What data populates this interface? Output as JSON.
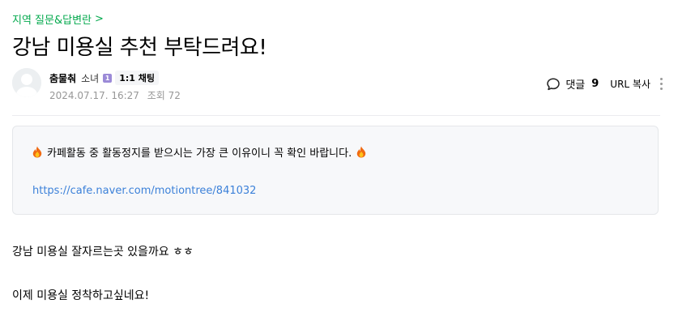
{
  "board": {
    "name": "지역 질문&답변란",
    "chevron": ">"
  },
  "post": {
    "title": "강남 미용실 추천 부탁드려요!",
    "author": {
      "name": "춤물춰",
      "rank": "소녀",
      "rank_icon_text": "1",
      "chat_label": "1:1 채팅"
    },
    "date": "2024.07.17. 16:27",
    "views_label": "조회 72",
    "comment_label": "댓글",
    "comment_count": "9",
    "url_copy_label": "URL 복사"
  },
  "notice": {
    "text": "카페활동 중 활동정지를 받으시는 가장 큰 이유이니 꼭 확인 바랍니다.",
    "link": "https://cafe.naver.com/motiontree/841032",
    "icon": "fire-icon"
  },
  "body": {
    "line1": "강남 미용실 잘자르는곳 있을까요 ㅎㅎ",
    "line2": "이제 미용실 정착하고싶네요!"
  },
  "colors": {
    "board_link": "#03a94d",
    "link": "#3c81d9",
    "meta": "#979797",
    "notice_bg": "#f7f8fa"
  }
}
